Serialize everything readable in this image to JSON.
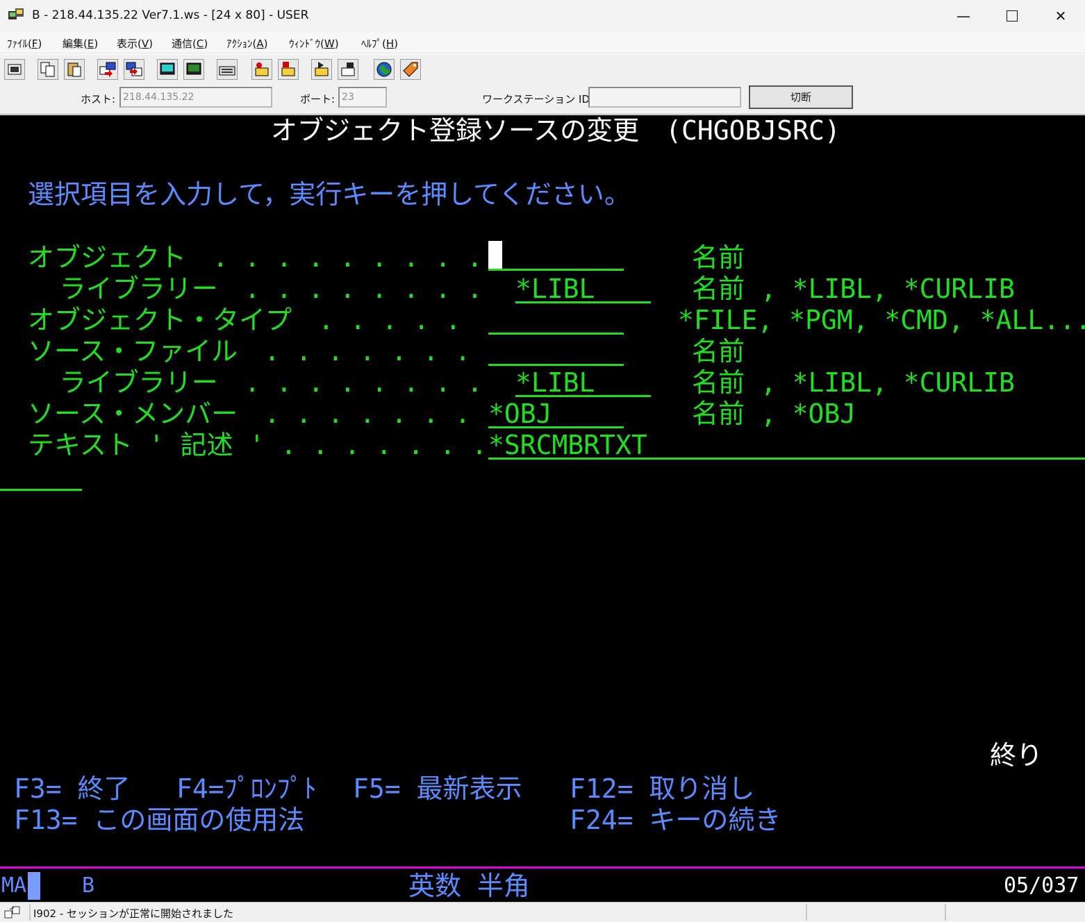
{
  "window": {
    "title": "B - 218.44.135.22 Ver7.1.ws - [24 x 80] - USER"
  },
  "menu": [
    {
      "label": "ﾌｧｲﾙ(",
      "key": "F",
      "end": ")"
    },
    {
      "label": "編集(",
      "key": "E",
      "end": ")"
    },
    {
      "label": "表示(",
      "key": "V",
      "end": ")"
    },
    {
      "label": "通信(",
      "key": "C",
      "end": ")"
    },
    {
      "label": "ｱｸｼｮﾝ(",
      "key": "A",
      "end": ")"
    },
    {
      "label": "ｳｨﾝﾄﾞｳ(",
      "key": "W",
      "end": ")"
    },
    {
      "label": "ﾍﾙﾌﾟ(",
      "key": "H",
      "end": ")"
    }
  ],
  "toolbar_icons": [
    "print-screen-icon",
    "copy-icon",
    "paste-icon",
    "send-icon",
    "receive-icon",
    "display-icon",
    "display-settings-icon",
    "keyboard-map-icon",
    "macro-record-icon",
    "macro-stop-icon",
    "macro-play-icon",
    "macro-edit-icon",
    "globe-icon",
    "tag-icon"
  ],
  "hostbar": {
    "host_label": "ホスト:",
    "host_value": "218.44.135.22",
    "port_label": "ポート:",
    "port_value": "23",
    "ws_label": "ワークステーション ID:",
    "ws_value": "",
    "disconnect_label": "切断"
  },
  "screen": {
    "title": "オブジェクト登録ソースの変更　(CHGOBJSRC)",
    "instruction": "選択項目を入力して，実行キーを押してください。",
    "fields": [
      {
        "label": "オブジェクト　. . . . . . . . .",
        "value": "",
        "hint": "名前"
      },
      {
        "label": "  ライブラリー　. . . . . . . .",
        "value": "*LIBL",
        "hint": "名前 , *LIBL, *CURLIB"
      },
      {
        "label": "オブジェクト・タイプ　. . . . .",
        "value": "",
        "hint": "*FILE, *PGM, *CMD, *ALL..."
      },
      {
        "label": "ソース・ファイル　. . . . . . .",
        "value": "",
        "hint": "名前"
      },
      {
        "label": "  ライブラリー　. . . . . . . .",
        "value": "*LIBL",
        "hint": "名前 , *LIBL, *CURLIB"
      },
      {
        "label": "ソース・メンバー　. . . . . . .",
        "value": "*OBJ",
        "hint": "名前 , *OBJ"
      },
      {
        "label": "テキスト ' 記述 ' . . . . . . .",
        "value": "*SRCMBRTXT",
        "hint": ""
      }
    ],
    "end_marker": "終り",
    "fkeys_row1": [
      {
        "key": "F3=",
        "text": "終了"
      },
      {
        "key": "F4=",
        "text": "ﾌﾟﾛﾝﾌﾟﾄ"
      },
      {
        "key": "F5=",
        "text": "最新表示"
      },
      {
        "key": "F12=",
        "text": "取り消し"
      }
    ],
    "fkeys_row2": [
      {
        "key": "F13=",
        "text": "この画面の使用法"
      },
      {
        "key": "F24=",
        "text": "キーの続き"
      }
    ]
  },
  "oia": {
    "left": "MA",
    "session": "B",
    "mode": "英数 半角",
    "cursor_pos": "05/037"
  },
  "status": {
    "message": "I902 - セッションが正常に開始されました"
  }
}
